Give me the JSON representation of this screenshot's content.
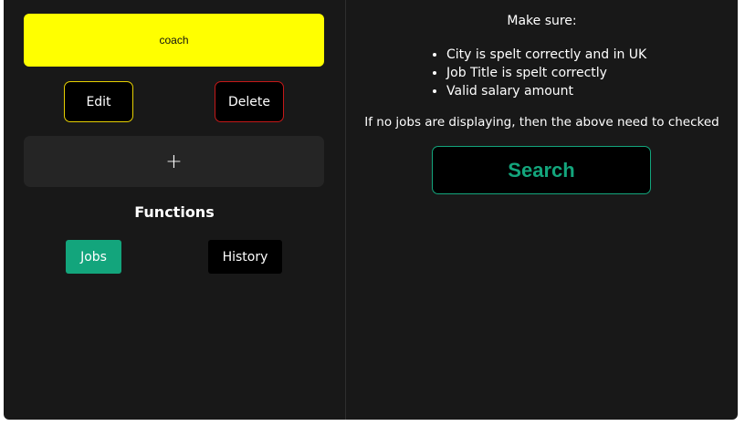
{
  "term": {
    "value": "coach",
    "color": "#ffff00"
  },
  "actions": {
    "edit_label": "Edit",
    "delete_label": "Delete",
    "add_label": "+"
  },
  "functions": {
    "title": "Functions",
    "jobs_label": "Jobs",
    "history_label": "History"
  },
  "info": {
    "heading": "Make sure:",
    "tips": [
      "City is spelt correctly and in UK",
      "Job Title is spelt correctly",
      "Valid salary amount"
    ],
    "note": "If no jobs are displaying, then the above need to checked"
  },
  "search": {
    "label": "Search"
  },
  "colors": {
    "background": "#181818",
    "accent": "#13a57c",
    "edit_border": "#e6d000",
    "delete_border": "#c41818"
  }
}
